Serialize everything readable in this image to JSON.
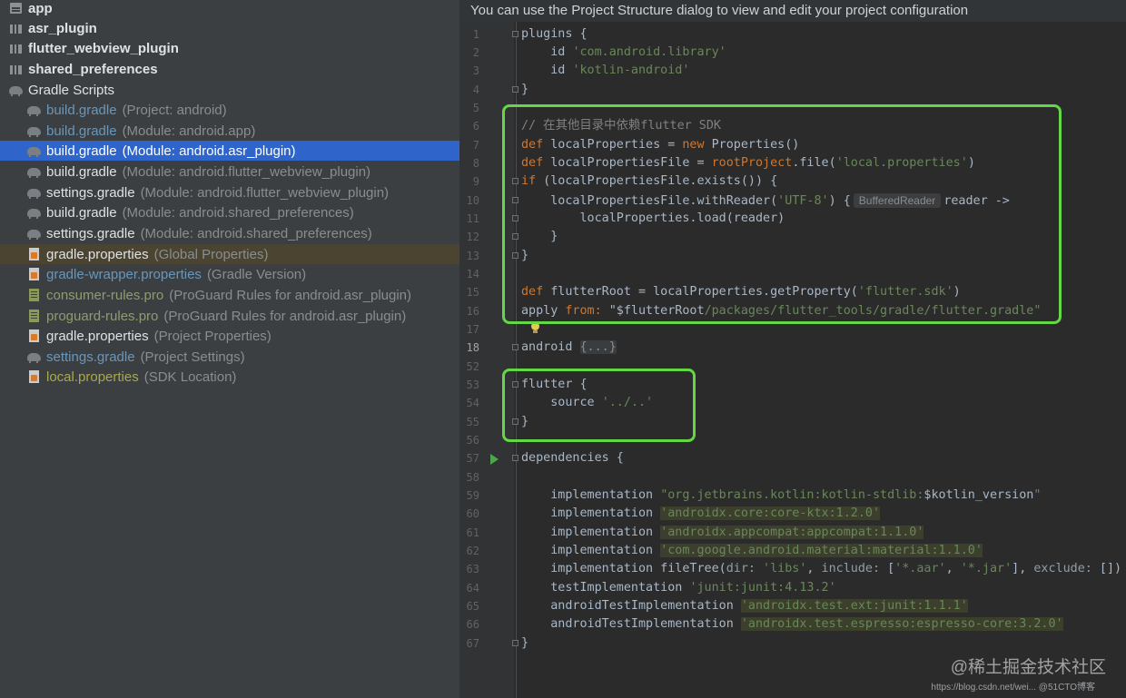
{
  "tree": {
    "items": [
      {
        "name": "app",
        "hint": ""
      },
      {
        "name": "asr_plugin",
        "hint": ""
      },
      {
        "name": "flutter_webview_plugin",
        "hint": ""
      },
      {
        "name": "shared_preferences",
        "hint": ""
      },
      {
        "name": "Gradle Scripts",
        "hint": ""
      },
      {
        "name": "build.gradle",
        "hint": "(Project: android)"
      },
      {
        "name": "build.gradle",
        "hint": "(Module: android.app)"
      },
      {
        "name": "build.gradle",
        "hint": "(Module: android.asr_plugin)"
      },
      {
        "name": "build.gradle",
        "hint": "(Module: android.flutter_webview_plugin)"
      },
      {
        "name": "settings.gradle",
        "hint": "(Module: android.flutter_webview_plugin)"
      },
      {
        "name": "build.gradle",
        "hint": "(Module: android.shared_preferences)"
      },
      {
        "name": "settings.gradle",
        "hint": "(Module: android.shared_preferences)"
      },
      {
        "name": "gradle.properties",
        "hint": "(Global Properties)"
      },
      {
        "name": "gradle-wrapper.properties",
        "hint": "(Gradle Version)"
      },
      {
        "name": "consumer-rules.pro",
        "hint": "(ProGuard Rules for android.asr_plugin)"
      },
      {
        "name": "proguard-rules.pro",
        "hint": "(ProGuard Rules for android.asr_plugin)"
      },
      {
        "name": "gradle.properties",
        "hint": "(Project Properties)"
      },
      {
        "name": "settings.gradle",
        "hint": "(Project Settings)"
      },
      {
        "name": "local.properties",
        "hint": "(SDK Location)"
      }
    ],
    "selected_index": 7
  },
  "editor": {
    "banner": "You can use the Project Structure dialog to view and edit your project configuration",
    "line_numbers": [
      "1",
      "2",
      "3",
      "4",
      "5",
      "6",
      "7",
      "8",
      "9",
      "10",
      "11",
      "12",
      "13",
      "14",
      "15",
      "16",
      "17",
      "18",
      "52",
      "53",
      "54",
      "55",
      "56",
      "57",
      "58",
      "59",
      "60",
      "61",
      "62",
      "63",
      "64",
      "65",
      "66",
      "67"
    ],
    "current_line": "18",
    "code": {
      "l1": {
        "a": "plugins {"
      },
      "l2": {
        "a": "    id ",
        "b": "'com.android.library'"
      },
      "l3": {
        "a": "    id ",
        "b": "'kotlin-android'"
      },
      "l4": {
        "a": "}"
      },
      "l6": {
        "a": "// 在其他目录中依赖flutter SDK"
      },
      "l7": {
        "a": "def",
        "b": " localProperties = ",
        "c": "new",
        "d": " Properties()"
      },
      "l8": {
        "a": "def",
        "b": " localPropertiesFile = ",
        "c": "rootProject",
        "d": ".file(",
        "e": "'local.properties'",
        "f": ")"
      },
      "l9": {
        "a": "if",
        "b": " (localPropertiesFile.exists()) {"
      },
      "l10": {
        "a": "    localPropertiesFile.withReader(",
        "b": "'UTF-8'",
        "c": ") {",
        "hint": "BufferedReader",
        "d": "reader ->"
      },
      "l11": {
        "a": "        localProperties.load(reader)"
      },
      "l12": {
        "a": "    }"
      },
      "l13": {
        "a": "}"
      },
      "l15": {
        "a": "def",
        "b": " flutterRoot = localProperties.getProperty(",
        "c": "'flutter.sdk'",
        "d": ")"
      },
      "l16": {
        "a": "apply ",
        "b": "from:",
        "c": " \"$flutterRoot",
        "d": "/packages/flutter_tools/gradle/flutter.gradle\""
      },
      "l18": {
        "a": "android ",
        "b": "{...}"
      },
      "l53": {
        "a": "flutter {"
      },
      "l54": {
        "a": "    source ",
        "b": "'../..'"
      },
      "l55": {
        "a": "}"
      },
      "l57": {
        "a": "dependencies {"
      },
      "l59": {
        "a": "    implementation ",
        "b": "\"org.jetbrains.kotlin:kotlin-stdlib:",
        "c": "$kotlin_version",
        "d": "\""
      },
      "l60": {
        "a": "    implementation ",
        "b": "'androidx.core:core-ktx:1.2.0'"
      },
      "l61": {
        "a": "    implementation ",
        "b": "'androidx.appcompat:appcompat:1.1.0'"
      },
      "l62": {
        "a": "    implementation ",
        "b": "'com.google.android.material:material:1.1.0'"
      },
      "l63": {
        "a": "    implementation fileTree(",
        "b": "dir:",
        "c": " ",
        "d": "'libs'",
        "e": ", ",
        "f": "include:",
        "g": " [",
        "h": "'*.aar'",
        "i": ", ",
        "j": "'*.jar'",
        "k": "], ",
        "l": "exclude:",
        "m": " [])"
      },
      "l64": {
        "a": "    testImplementation ",
        "b": "'junit:junit:4.13.2'"
      },
      "l65": {
        "a": "    androidTestImplementation ",
        "b": "'androidx.test.ext:junit:1.1.1'"
      },
      "l66": {
        "a": "    androidTestImplementation ",
        "b": "'androidx.test.espresso:espresso-core:3.2.0'"
      },
      "l67": {
        "a": "}"
      }
    }
  },
  "watermark": {
    "main": "@稀土掘金技术社区",
    "sub": "https://blog.csdn.net/wei... @51CTO博客"
  },
  "colors": {
    "highlight_box": "#63d844",
    "selection": "#2f65ca",
    "keyword": "#cc7832",
    "string": "#6a8759"
  },
  "icons": [
    "module-icon",
    "gradle-elephant-icon",
    "properties-file-icon",
    "proguard-file-icon",
    "run-gutter-icon",
    "lightbulb-icon"
  ]
}
